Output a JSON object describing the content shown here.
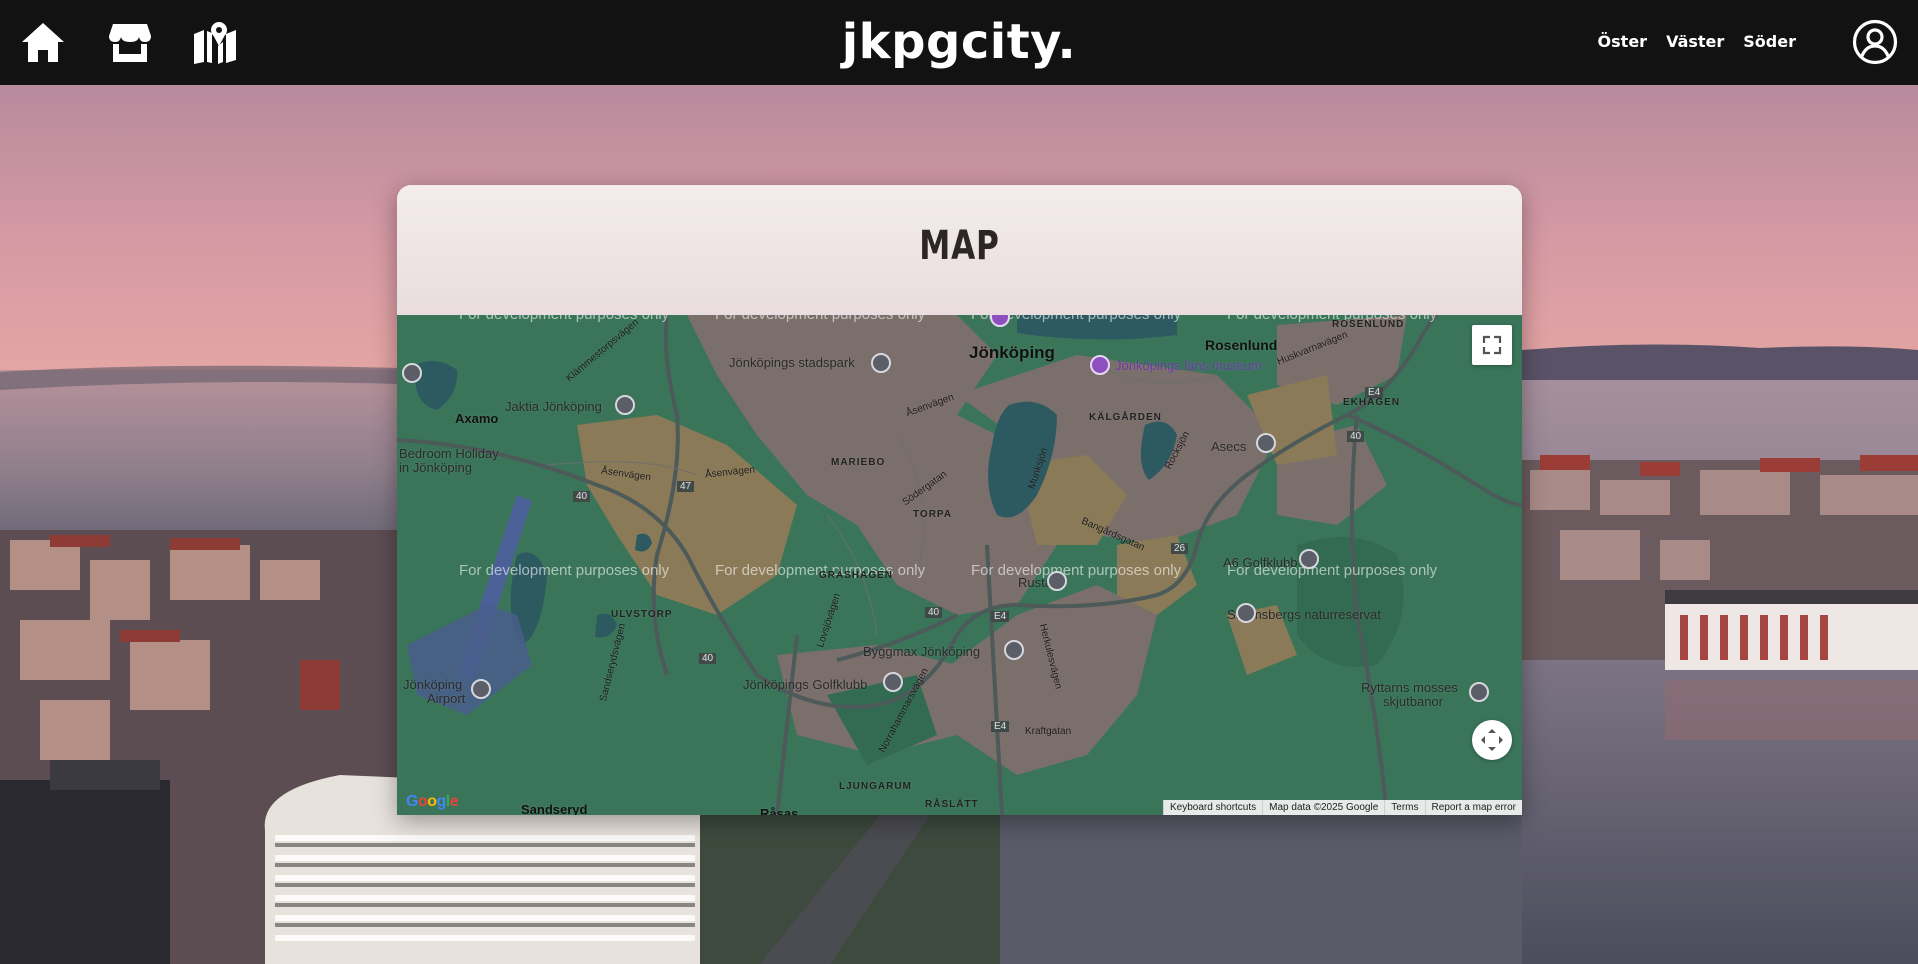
{
  "header": {
    "brand": "jkpgcity.",
    "nav_icons": [
      "home-icon",
      "store-icon",
      "map-icon"
    ],
    "links": [
      "Öster",
      "Väster",
      "Söder"
    ],
    "profile_icon": "user-circle-icon"
  },
  "card": {
    "title": "MAP"
  },
  "map": {
    "watermark": "For development purposes only",
    "labels": {
      "jonkoping": "Jönköping",
      "rosenlund_big": "Rosenlund",
      "rosenlund_small": "ROSENLUND",
      "ekhagen": "EKHAGEN",
      "kalgarden": "KÄLGÅRDEN",
      "marieboo": "MARIEBO",
      "torpa": "TORPA",
      "grashagen": "GRÄSHAGEN",
      "ulvstorp": "ULVSTORP",
      "ljungarum": "LJUNGARUM",
      "raslatt": "RÅSLÄTT",
      "axamo": "Axamo",
      "sandseryd": "Sandseryd",
      "rasas": "Råsas",
      "rusta": "Rusta",
      "asecs": "Asecs",
      "stadspark": "Jönköpings stadspark",
      "lans_museum": "Jönköpings läns museum",
      "jaktia": "Jaktia Jönköping",
      "bedroom_1": "Bedroom Holiday",
      "bedroom_2": "in Jönköping",
      "airport_1": "Jönköping",
      "airport_2": "Airport",
      "golfklubb": "Jönköpings Golfklubb",
      "byggmax": "Byggmax Jönköping",
      "a6golf": "A6 Golfklubb",
      "stromsberg": "Strömsbergs naturreservat",
      "ryttarns_1": "Ryttarns mosses",
      "ryttarns_2": "skjutbanor",
      "klamme": "Klämmestorpsvägen",
      "asenvagen_1": "Åsenvägen",
      "asenvagen_2": "Åsenvägen",
      "asenvagen_3": "Åsenvägen",
      "sodergatan": "Södergatan",
      "munksjon": "Munksjön",
      "rocksjon": "Rocksjön",
      "bangard": "Bangårdsgatan",
      "huskvarnavagen": "Huskvarnavägen",
      "lovsta": "Lovsjövägen",
      "sandseryds": "Sandserydsvägen",
      "norrahamnar": "Norrahammarsvägen",
      "herkules": "Herkulesvägen",
      "kraftgatan": "Kraftgatan",
      "r40a": "40",
      "r40b": "40",
      "r40c": "40",
      "r40d": "40",
      "r47": "47",
      "e4a": "E4",
      "e4b": "E4",
      "e4c": "E4",
      "r26": "26"
    },
    "controls": {
      "fullscreen_icon": "fullscreen-icon",
      "camera_icon": "camera-control-icon"
    },
    "google_logo": "Google",
    "attribution": [
      "Keyboard shortcuts",
      "Map data ©2025 Google",
      "Terms",
      "Report a map error"
    ]
  },
  "colors": {
    "header_bg": "#121212",
    "map_green": "#3a755a",
    "card_head": "#f2e9ea"
  }
}
